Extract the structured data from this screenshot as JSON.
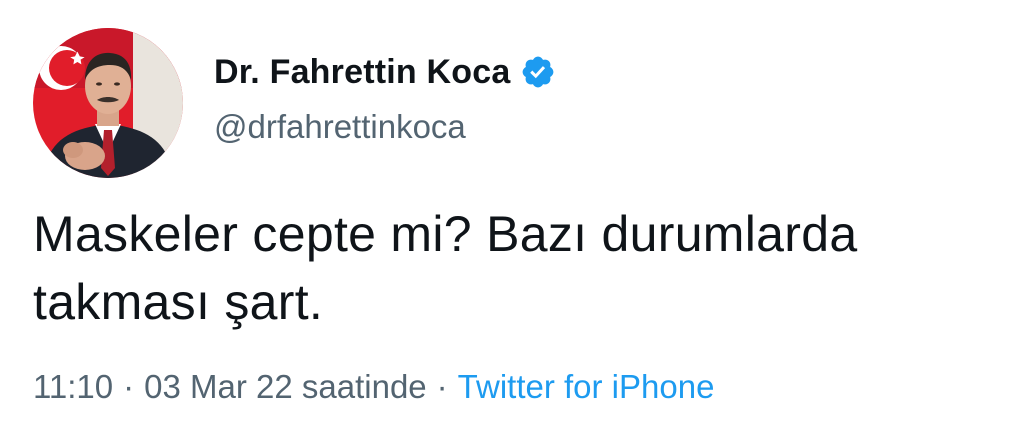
{
  "author": {
    "display_name": "Dr. Fahrettin Koca",
    "handle": "@drfahrettinkoca",
    "verified": true
  },
  "tweet": {
    "text_line1": "Maskeler cepte mi? Bazı durumlarda",
    "text_line2": "takması şart."
  },
  "meta": {
    "time": "11:10",
    "separator": "·",
    "date": "03 Mar 22 saatinde",
    "source": "Twitter for iPhone"
  },
  "icons": {
    "verified": "verified-badge-icon",
    "avatar": "profile-photo"
  },
  "colors": {
    "name": "#0f1419",
    "secondary": "#536471",
    "link": "#1d9bf0",
    "verified": "#1d9bf0"
  }
}
